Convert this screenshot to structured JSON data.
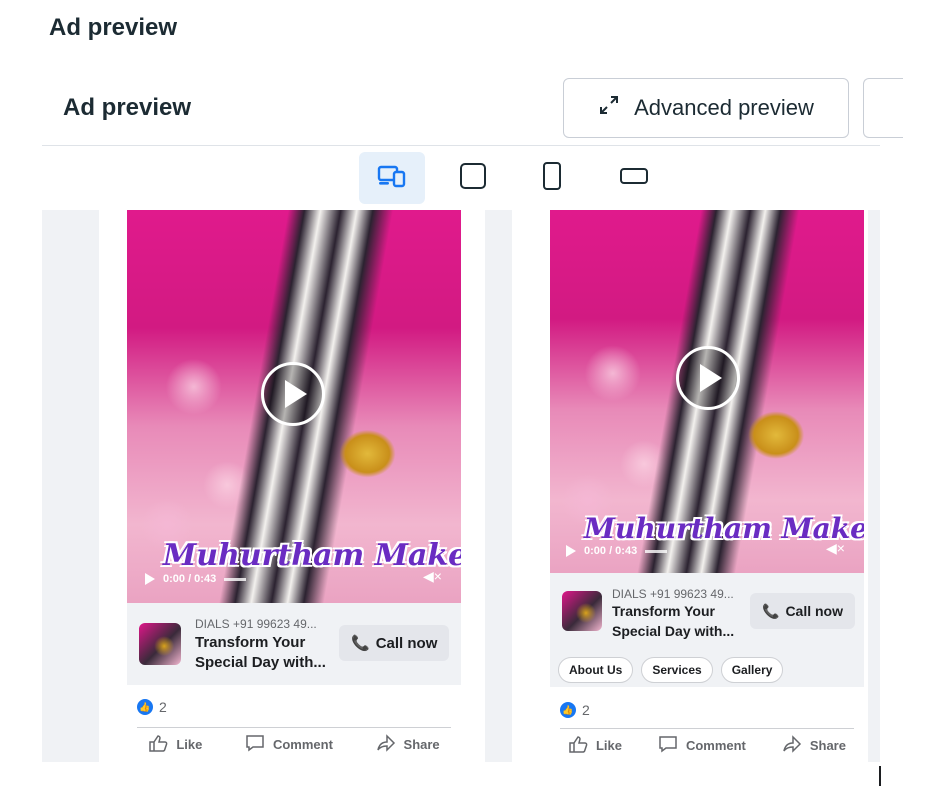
{
  "outer_title": "Ad preview",
  "panel": {
    "title": "Ad preview",
    "advanced_preview_label": "Advanced preview"
  },
  "device_bar": {
    "options": [
      "responsive-icon",
      "square-icon",
      "mobile-portrait-icon",
      "landscape-icon"
    ],
    "active": "responsive-icon"
  },
  "cards": [
    {
      "caption": "Muhurtham Makeup",
      "video_time": "0:00 / 0:43",
      "dials": "DIALS +91 99623 49...",
      "headline_line1": "Transform Your",
      "headline_line2": "Special Day with...",
      "cta": "Call now",
      "reaction_count": "2",
      "actions": {
        "like": "Like",
        "comment": "Comment",
        "share": "Share"
      }
    },
    {
      "caption": "Muhurtham Makeup",
      "video_time": "0:00 / 0:43",
      "dials": "DIALS +91 99623 49...",
      "headline_line1": "Transform Your",
      "headline_line2": "Special Day with...",
      "cta": "Call now",
      "chips": [
        "About Us",
        "Services",
        "Gallery"
      ],
      "reaction_count": "2",
      "actions": {
        "like": "Like",
        "comment": "Comment",
        "share": "Share"
      }
    }
  ],
  "colors": {
    "accent": "#1877f2",
    "active_tab_bg": "#e6f0fa",
    "caption_purple": "#6a2cc2",
    "panel_bg": "#f0f2f5"
  }
}
